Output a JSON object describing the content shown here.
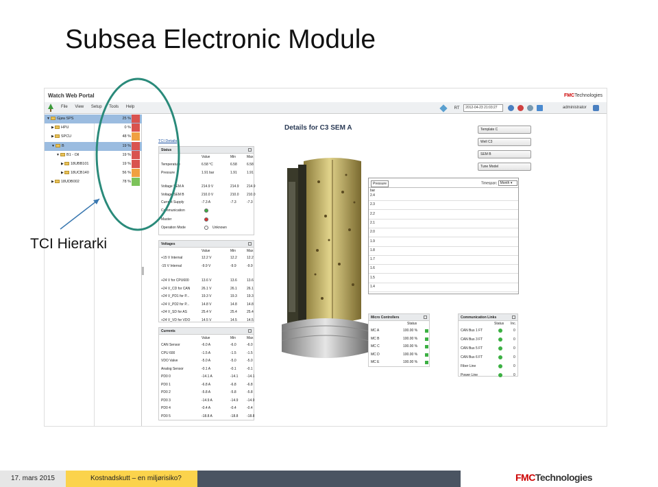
{
  "slide": {
    "title": "Subsea Electronic Module",
    "annotation": "TCI Hierarki",
    "footer_date": "17. mars 2015",
    "footer_title": "Kostnadskutt – en miljørisiko?",
    "logo_a": "FMC",
    "logo_b": "Technologies"
  },
  "portal": {
    "title": "Watch Web Portal",
    "logo_a": "FMC",
    "logo_b": "Technologies",
    "menu": [
      "File",
      "View",
      "Setup",
      "Tools",
      "Help"
    ],
    "rt_label": "RT",
    "rt_value": "2012-04-23 21:03:27",
    "user": "administrator"
  },
  "tree": [
    {
      "label": "Gjøa SPS",
      "pct": "25 %",
      "indent": 0,
      "expanded": true,
      "selected": true,
      "color": "#d9534f"
    },
    {
      "label": "HPU",
      "pct": "0 %",
      "indent": 1,
      "expanded": false,
      "selected": false,
      "color": "#d9534f"
    },
    {
      "label": "SPCU",
      "pct": "48 %",
      "indent": 1,
      "expanded": false,
      "selected": false,
      "color": "#f0a040"
    },
    {
      "label": "B",
      "pct": "19 %",
      "indent": 1,
      "expanded": true,
      "selected": true,
      "color": "#d9534f"
    },
    {
      "label": "B1 - Oil",
      "pct": "19 %",
      "indent": 2,
      "expanded": true,
      "selected": false,
      "color": "#d9534f"
    },
    {
      "label": "18UBB101",
      "pct": "19 %",
      "indent": 3,
      "expanded": false,
      "selected": false,
      "color": "#d9534f"
    },
    {
      "label": "18UCB140",
      "pct": "56 %",
      "indent": 3,
      "expanded": false,
      "selected": false,
      "color": "#f0a040"
    },
    {
      "label": "18UDB002",
      "pct": "78 %",
      "indent": 1,
      "expanded": false,
      "selected": false,
      "color": "#7cc35a"
    }
  ],
  "details": {
    "tci_link": "TCI Details",
    "title": "Details for C3 SEM A",
    "templates": [
      "Template C",
      "Well C3",
      "SEM B",
      "Tune Model"
    ]
  },
  "status": {
    "header": "Status",
    "cols": [
      "Value",
      "Min",
      "Max"
    ],
    "rows": [
      {
        "name": "Temperature",
        "value": "6.58 °C",
        "min": "6.58",
        "max": "6.58"
      },
      {
        "name": "Pressure",
        "value": "1.91 bar",
        "min": "1.91",
        "max": "1.91"
      },
      {
        "name": "Voltage SEM A",
        "value": "214.9 V",
        "min": "214.9",
        "max": "214.9"
      },
      {
        "name": "Voltage SEM B",
        "value": "210.0 V",
        "min": "210.0",
        "max": "210.0"
      },
      {
        "name": "Current Supply",
        "value": "-7.3 A",
        "min": "-7.3",
        "max": "-7.3"
      }
    ],
    "states": [
      {
        "name": "Communication",
        "value": "",
        "color": "#3cb043"
      },
      {
        "name": "Master",
        "value": "",
        "color": "#e03030"
      },
      {
        "name": "Operation Mode",
        "value": "Unknown",
        "color": "#ffffff"
      }
    ]
  },
  "voltages": {
    "header": "Voltages",
    "cols": [
      "Value",
      "Min",
      "Max"
    ],
    "rows": [
      {
        "name": "+15 V Internal",
        "value": "12.2 V",
        "min": "12.2",
        "max": "12.2"
      },
      {
        "name": "-15 V Internal",
        "value": "-9.9 V",
        "min": "-9.9",
        "max": "-9.9"
      },
      {
        "name": "+24 V for CPU600",
        "value": "13.6 V",
        "min": "13.6",
        "max": "13.6"
      },
      {
        "name": "+24 V_CD for CAN",
        "value": "26.1 V",
        "min": "26.1",
        "max": "26.1"
      },
      {
        "name": "+24 V_PD1 for P...",
        "value": "19.3 V",
        "min": "19.3",
        "max": "19.3"
      },
      {
        "name": "+24 V_PD2 for P...",
        "value": "14.8 V",
        "min": "14.8",
        "max": "14.8"
      },
      {
        "name": "+24 V_SD for AS",
        "value": "25.4 V",
        "min": "25.4",
        "max": "25.4"
      },
      {
        "name": "+24 V_VD for VDO",
        "value": "14.5 V",
        "min": "14.5",
        "max": "14.5"
      }
    ]
  },
  "currents": {
    "header": "Currents",
    "cols": [
      "Value",
      "Min",
      "Max"
    ],
    "rows": [
      {
        "name": "CAN Sensor",
        "value": "-6.0 A",
        "min": "-6.0",
        "max": "-6.0"
      },
      {
        "name": "CPU 600",
        "value": "-1.5 A",
        "min": "-1.5",
        "max": "-1.5"
      },
      {
        "name": "VDO Valve",
        "value": "-5.0 A",
        "min": "-5.0",
        "max": "-5.0"
      },
      {
        "name": "Analog Sensor",
        "value": "-0.1 A",
        "min": "-0.1",
        "max": "-0.1"
      },
      {
        "name": "PD0 0",
        "value": "-14.1 A",
        "min": "-14.1",
        "max": "-14.1"
      },
      {
        "name": "PD0 1",
        "value": "-6.8 A",
        "min": "-6.8",
        "max": "-6.8"
      },
      {
        "name": "PD0 2",
        "value": "-5.8 A",
        "min": "-5.8",
        "max": "-5.8"
      },
      {
        "name": "PD0 3",
        "value": "-14.9 A",
        "min": "-14.9",
        "max": "-14.9"
      },
      {
        "name": "PD0 4",
        "value": "-0.4 A",
        "min": "-0.4",
        "max": "-0.4"
      },
      {
        "name": "PD0 5",
        "value": "-18.8 A",
        "min": "-18.8",
        "max": "-18.8"
      }
    ]
  },
  "pressure_chart": {
    "label": "Pressure",
    "timespan_label": "Timespan:",
    "timespan_value": "Month",
    "unit": "bar",
    "ticks": [
      "2.4",
      "2.3",
      "2.2",
      "2.1",
      "2.0",
      "1.9",
      "1.8",
      "1.7",
      "1.6",
      "1.5",
      "1.4"
    ]
  },
  "micro_controllers": {
    "header": "Micro Controllers",
    "col": "Status",
    "rows": [
      {
        "name": "MC A",
        "value": "100.00 %"
      },
      {
        "name": "MC B",
        "value": "100.00 %"
      },
      {
        "name": "MC C",
        "value": "100.00 %"
      },
      {
        "name": "MC D",
        "value": "100.00 %"
      },
      {
        "name": "MC E",
        "value": "100.00 %"
      }
    ]
  },
  "comm_links": {
    "header": "Communication Links",
    "cols": [
      "Status",
      "Inc."
    ],
    "rows": [
      {
        "name": "CAN Bus 1 FT",
        "inc": "0"
      },
      {
        "name": "CAN Bus 3 FT",
        "inc": "0"
      },
      {
        "name": "CAN Bus 5 FT",
        "inc": "0"
      },
      {
        "name": "CAN Bus 6 FT",
        "inc": "0"
      },
      {
        "name": "Fiber Line",
        "inc": "0"
      },
      {
        "name": "Power Line",
        "inc": "0"
      }
    ]
  },
  "colors": {
    "ok": "#3cb043",
    "error": "#e03030",
    "highlight": "#2a8a7a",
    "footer_yellow": "#fbd34c",
    "footer_dark": "#4a5462",
    "fmc_red": "#cc0000"
  }
}
